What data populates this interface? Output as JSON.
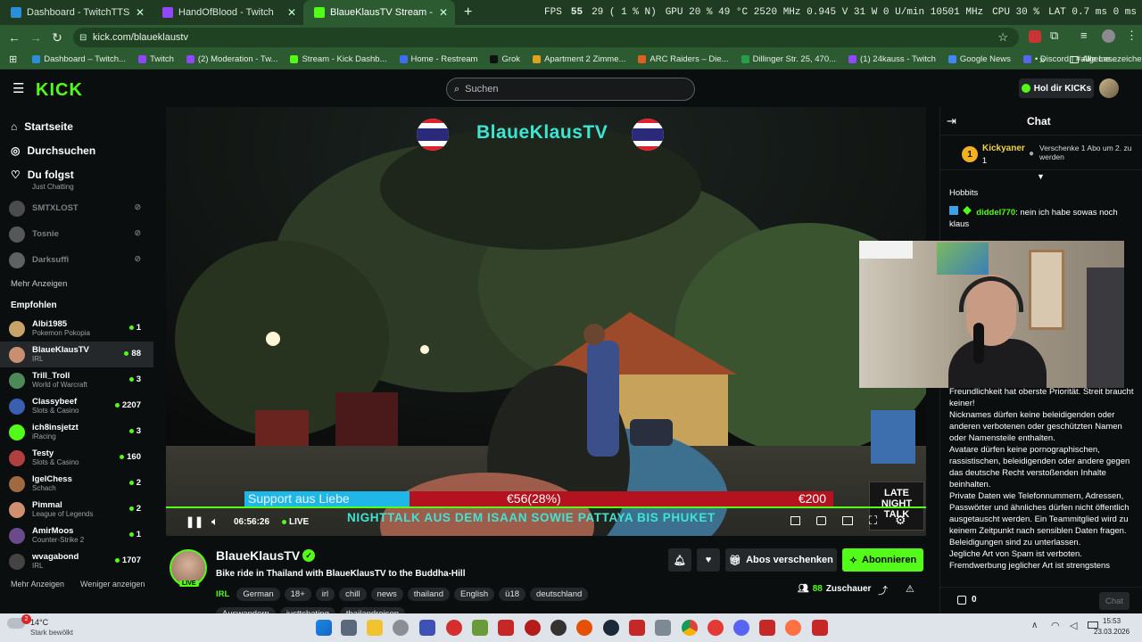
{
  "browser": {
    "tabs": [
      {
        "title": "Dashboard - TwitchTTS",
        "favicon_color": "#2a8fd8"
      },
      {
        "title": "HandOfBlood - Twitch",
        "favicon_color": "#9146ff"
      },
      {
        "title": "BlaueKlausTV Stream - Wat",
        "favicon_color": "#53fc18"
      }
    ],
    "new_tab": "+",
    "url": "kick.com/blaueklaustv",
    "bookmarks": [
      {
        "label": "Dashboard – Twitch...",
        "color": "#2a8fd8"
      },
      {
        "label": "Twitch",
        "color": "#9146ff"
      },
      {
        "label": "(2) Moderation - Tw...",
        "color": "#9146ff"
      },
      {
        "label": "Stream - Kick Dashb...",
        "color": "#53fc18"
      },
      {
        "label": "Home - Restream",
        "color": "#3b6ef5"
      },
      {
        "label": "Grok",
        "color": "#111111"
      },
      {
        "label": "Apartment 2 Zimme...",
        "color": "#e0a020"
      },
      {
        "label": "ARC Raiders – Die...",
        "color": "#e06020"
      },
      {
        "label": "Dillinger Str. 25, 470...",
        "color": "#2a9d4a"
      },
      {
        "label": "(1) 24kauss - Twitch",
        "color": "#9146ff"
      },
      {
        "label": "Google News",
        "color": "#4285f4"
      },
      {
        "label": "• Discord | #allgeme...",
        "color": "#5865f2"
      }
    ],
    "bookmarks_more": "»",
    "all_bookmarks": "Alle Lesezeichen"
  },
  "sysstats": {
    "fps_label": "FPS",
    "fps": "55",
    "fps_low": "29 ( 1 % N)",
    "gpu": "GPU 20 % 49 °C 2520 MHz 0.945 V 31 W 0 U/min 10501 MHz",
    "cpu": "CPU 30 %",
    "lat": "LAT 0.7 ms 0 ms"
  },
  "kick": {
    "search_placeholder": "Suchen",
    "get_kicks": "Hol dir KICKs"
  },
  "sidebar": {
    "nav": [
      {
        "label": "Startseite",
        "icon": "home-icon"
      },
      {
        "label": "Durchsuchen",
        "icon": "compass-icon"
      },
      {
        "label": "Du folgst",
        "icon": "heart-icon"
      }
    ],
    "followed_partial_category": "Just Chatting",
    "followed": [
      {
        "name": "SMTXLOST",
        "color": "#777"
      },
      {
        "name": "Tosnie",
        "color": "#888"
      },
      {
        "name": "Darksuffi",
        "color": "#999"
      }
    ],
    "show_more": "Mehr Anzeigen",
    "recommended_label": "Empfohlen",
    "recommended": [
      {
        "name": "Albi1985",
        "category": "Pokemon Pokopia",
        "viewers": "1",
        "color": "#c7a36a"
      },
      {
        "name": "BlaueKlausTV",
        "category": "IRL",
        "viewers": "88",
        "color": "#c89070"
      },
      {
        "name": "Trill_Troll",
        "category": "World of Warcraft",
        "viewers": "3",
        "color": "#4d8a5a"
      },
      {
        "name": "Classybeef",
        "category": "Slots & Casino",
        "viewers": "2207",
        "color": "#3a5fb0"
      },
      {
        "name": "ich8insjetzt",
        "category": "iRacing",
        "viewers": "3",
        "color": "#53fc18"
      },
      {
        "name": "Testy",
        "category": "Slots & Casino",
        "viewers": "160",
        "color": "#b04040"
      },
      {
        "name": "IgelChess",
        "category": "Schach",
        "viewers": "2",
        "color": "#a06a40"
      },
      {
        "name": "Pimmal",
        "category": "League of Legends",
        "viewers": "2",
        "color": "#d09070"
      },
      {
        "name": "AmirMoos",
        "category": "Counter-Strike 2",
        "viewers": "1",
        "color": "#6a4a8a"
      },
      {
        "name": "wvagabond",
        "category": "IRL",
        "viewers": "1707",
        "color": "#444"
      }
    ],
    "show_more_bottom": "Mehr Anzeigen",
    "show_less": "Weniger anzeigen"
  },
  "video": {
    "overlay_title": "BlaueKlausTV",
    "goal_label": "Support aus Liebe",
    "goal_current": "€56(28%)",
    "goal_target": "€200",
    "goal_progress": 0.28,
    "ticker": "NIGHTTALK AUS DEM ISAAN SOWIE PATTAYA BIS PHUKET",
    "late_night_logo": "LATE NIGHT TALK",
    "time": "06:56:26",
    "live_label": "LIVE"
  },
  "channel": {
    "name": "BlaueKlausTV",
    "title": "Bike ride in Thailand with BlaueKlausTV to the Buddha-Hill",
    "live_badge": "LIVE",
    "category": "IRL",
    "tags": [
      "German",
      "18+",
      "irl",
      "chill",
      "news",
      "thailand",
      "English",
      "ü18",
      "deutschland",
      "Auswandern",
      "justtchating",
      "thailandreisen"
    ],
    "gift_subs": "Abos verschenken",
    "subscribe": "Abonnieren",
    "viewers": "88",
    "viewers_label": "Zuschauer"
  },
  "chat": {
    "header": "Chat",
    "pinned_user": "Kickyaner",
    "pinned_rank": "1",
    "pinned_count": "1",
    "pinned_note": "Verschenke 1 Abo um 2. zu werden",
    "msg1": "Hobbits",
    "msg2_user": "diddel770",
    "msg2_text": "nein ich habe sowas noch klaus",
    "rules": [
      "Freundlichkeit hat oberste Priorität. Streit braucht keiner!",
      "Nicknames dürfen keine beleidigenden oder anderen verbotenen oder geschützten Namen oder Namensteile enthalten.",
      "Avatare dürfen keine pornographischen, rassistischen, beleidigenden oder andere gegen das deutsche Recht verstoßenden Inhalte beinhalten.",
      "Private Daten wie Telefonnummern, Adressen, Passwörter und ähnliches dürfen nicht öffentlich ausgetauscht werden. Ein Teammitglied wird zu keinem Zeitpunkt nach sensiblen Daten fragen.",
      "Beleidigungen sind zu unterlassen.",
      "Jegliche Art von Spam ist verboten.",
      "Fremdwerbung jeglicher Art ist strengstens"
    ],
    "kicks": "0",
    "send": "Chat"
  },
  "taskbar": {
    "weather_temp": "14°C",
    "weather_desc": "Stark bewölkt",
    "notif_count": "2",
    "time": "15:53",
    "date": "23.03.2026"
  }
}
